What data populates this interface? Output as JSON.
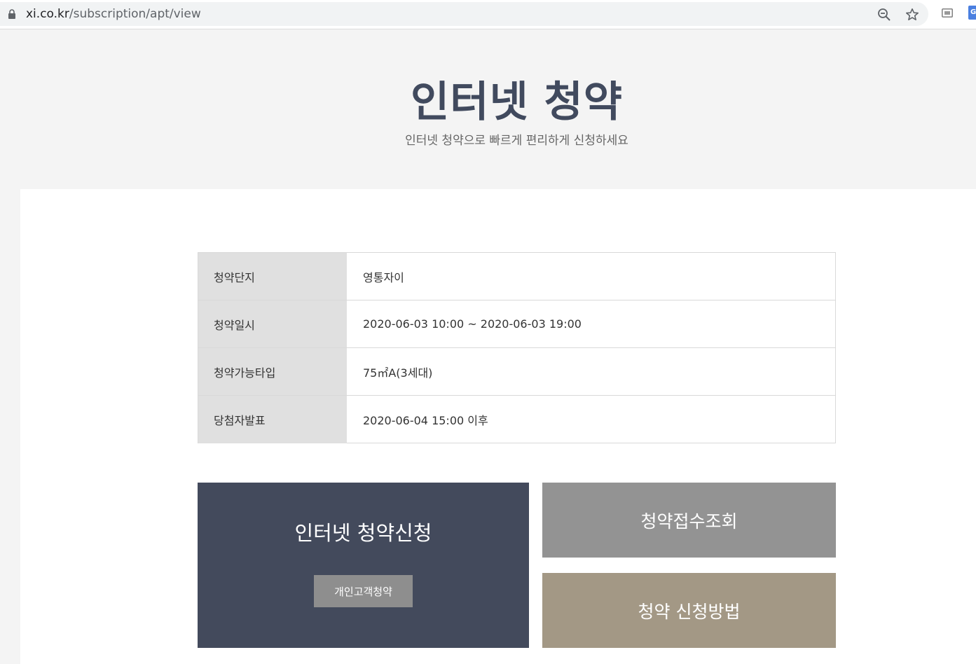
{
  "browser": {
    "url_host": "xi.co.kr",
    "url_path": "/subscription/apt/view",
    "ext_badge": "G"
  },
  "hero": {
    "title": "인터넷 청약",
    "subtitle": "인터넷 청약으로 빠르게 편리하게 신청하세요"
  },
  "info": {
    "rows": [
      {
        "label": "청약단지",
        "value": "영통자이"
      },
      {
        "label": "청약일시",
        "value": "2020-06-03 10:00 ~ 2020-06-03 19:00"
      },
      {
        "label": "청약가능타입",
        "value": "75㎡A(3세대)"
      },
      {
        "label": "당첨자발표",
        "value": "2020-06-04 15:00 이후"
      }
    ]
  },
  "actions": {
    "apply_title": "인터넷 청약신청",
    "personal_label": "개인고객청약",
    "lookup_label": "청약접수조회",
    "method_label": "청약 신청방법"
  },
  "colors": {
    "title": "#414a5e",
    "apply_bg": "#434a5c",
    "lookup_bg": "#939393",
    "method_bg": "#a39885",
    "personal_bg": "#8e8e8e"
  },
  "icons": {
    "lock": "lock-icon",
    "zoom": "zoom-out-icon",
    "star": "bookmark-star-icon",
    "ext1": "extension-icon"
  }
}
